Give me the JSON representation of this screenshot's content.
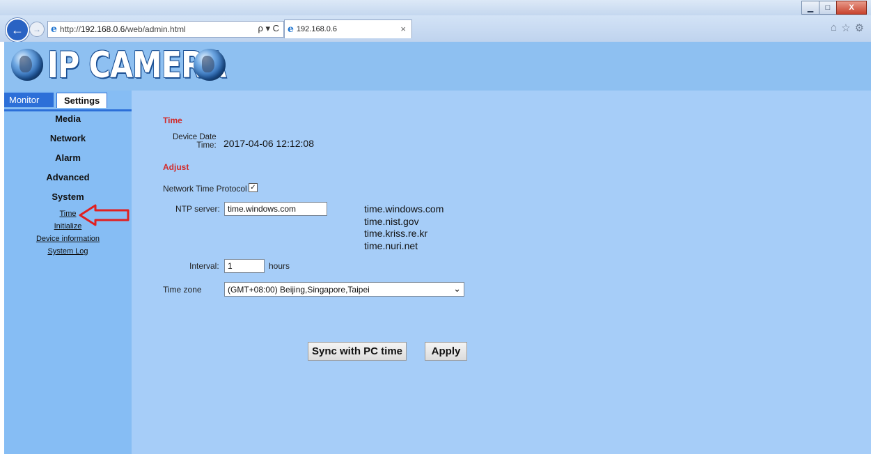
{
  "browser": {
    "url_prefix": "http://",
    "url_host": "192.168.0.6",
    "url_path": "/web/admin.html",
    "address_tools": "ρ ▾ C",
    "tab_title": "192.168.0.6",
    "tab_close": "×",
    "win_min": "▁",
    "win_max": "□",
    "win_close": "X",
    "home_glyph": "⌂",
    "star_glyph": "☆",
    "gear_glyph": "⚙"
  },
  "header": {
    "logo_text": "IP CAMERA"
  },
  "sidebar": {
    "tabs": {
      "monitor": "Monitor",
      "settings": "Settings"
    },
    "groups": {
      "media": "Media",
      "network": "Network",
      "alarm": "Alarm",
      "advanced": "Advanced",
      "system": "System"
    },
    "links": {
      "time": "Time",
      "initialize": "Initialize",
      "device_information": "Device information",
      "system_log": "System Log"
    }
  },
  "time_section": {
    "title": "Time",
    "device_date_label_line1": "Device Date",
    "device_date_label_line2": "Time:",
    "device_date_value": "2017-04-06 12:12:08"
  },
  "adjust_section": {
    "title": "Adjust",
    "ntp_label": "Network Time Protocol",
    "ntp_checked": "✓",
    "ntp_server_label": "NTP server:",
    "ntp_server_value": "time.windows.com",
    "ntp_servers": [
      "time.windows.com",
      "time.nist.gov",
      "time.kriss.re.kr",
      "time.nuri.net"
    ],
    "interval_label": "Interval:",
    "interval_value": "1",
    "interval_unit": "hours",
    "timezone_label": "Time zone",
    "timezone_value": "(GMT+08:00) Beijing,Singapore,Taipei"
  },
  "buttons": {
    "sync": "Sync with PC time",
    "apply": "Apply"
  },
  "colors": {
    "page_bg": "#a6cdf8",
    "sidebar_bg": "#86bdf4",
    "header_bg": "#8ec0f1",
    "accent": "#2c6fd8",
    "section_title": "#d12b2b",
    "arrow": "#e02020"
  }
}
